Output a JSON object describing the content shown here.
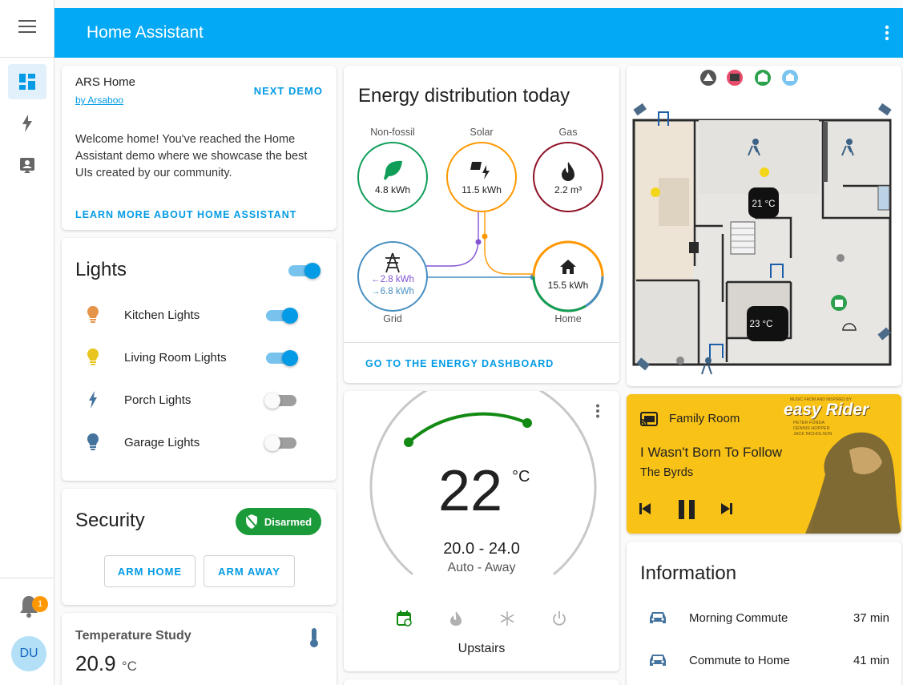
{
  "app": {
    "title": "Home Assistant"
  },
  "user": {
    "initials": "DU"
  },
  "notifications": {
    "count": "1"
  },
  "welcome": {
    "title": "ARS Home",
    "byline": "by Arsaboo",
    "next_demo": "NEXT DEMO",
    "text": "Welcome home! You've reached the Home Assistant demo where we showcase the best UIs created by our community.",
    "learn_more": "LEARN MORE ABOUT HOME ASSISTANT"
  },
  "lights": {
    "title": "Lights",
    "master_on": true,
    "items": [
      {
        "name": "Kitchen Lights",
        "on": true,
        "color": "#e6944a"
      },
      {
        "name": "Living Room Lights",
        "on": true,
        "color": "#e8c51f"
      },
      {
        "name": "Porch Lights",
        "on": false,
        "color": "#44739e"
      },
      {
        "name": "Garage Lights",
        "on": false,
        "color": "#44739e"
      }
    ]
  },
  "security": {
    "title": "Security",
    "status": "Disarmed",
    "arm_home": "ARM HOME",
    "arm_away": "ARM AWAY",
    "status_color": "#1b9a3a"
  },
  "temperature_study": {
    "title": "Temperature Study",
    "value": "20.9",
    "unit": "°C"
  },
  "energy": {
    "title": "Energy distribution today",
    "nonfossil": {
      "label": "Non-fossil",
      "value": "4.8 kWh",
      "color": "#0f9d58"
    },
    "solar": {
      "label": "Solar",
      "value": "11.5 kWh",
      "color": "#ff9800"
    },
    "gas": {
      "label": "Gas",
      "value": "2.2 m³",
      "color": "#8e0f26"
    },
    "grid": {
      "label": "Grid",
      "in": "←2.8 kWh",
      "out": "→6.8 kWh",
      "color": "#488fc2"
    },
    "home": {
      "label": "Home",
      "value": "15.5 kWh"
    },
    "return_color": "#8353d4",
    "dashboard_link": "GO TO THE ENERGY DASHBOARD"
  },
  "thermostat": {
    "temperature": "22",
    "unit": "°C",
    "range": "20.0 - 24.0",
    "mode": "Auto - Away",
    "name": "Upstairs",
    "accent": "#138a13"
  },
  "floorplan": {
    "temp_1": "21 °C",
    "temp_2": "23 °C"
  },
  "media": {
    "room": "Family Room",
    "track": "I Wasn't Born To Follow",
    "artist": "The Byrds",
    "album_art_text": "easy Rider",
    "credits_top": "MUSIC FROM AND INSPIRED BY",
    "credits": [
      "PETER FONDA",
      "DENNIS HOPPER",
      "JACK NICHOLSON"
    ],
    "bg_color": "#f9c216"
  },
  "information": {
    "title": "Information",
    "items": [
      {
        "name": "Morning Commute",
        "value": "37 min"
      },
      {
        "name": "Commute to Home",
        "value": "41 min"
      }
    ]
  }
}
